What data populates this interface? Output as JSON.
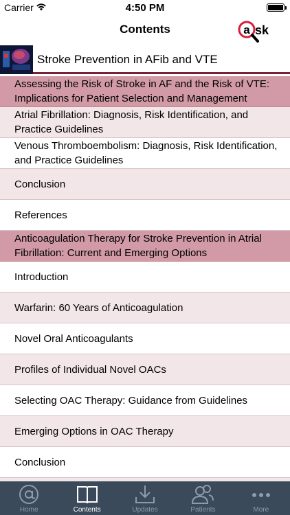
{
  "status": {
    "carrier": "Carrier",
    "time": "4:50 PM"
  },
  "nav": {
    "title": "Contents",
    "logo_text": "ask"
  },
  "book": {
    "title": "Stroke Prevention in AFib and VTE"
  },
  "list": [
    {
      "text": "Assessing the Risk of Stroke in AF and the Risk of VTE: Implications for Patient Selection and Management",
      "kind": "sec"
    },
    {
      "text": "Atrial Fibrillation: Diagnosis, Risk Identification, and Practice Guidelines",
      "kind": "alt"
    },
    {
      "text": "Venous Thromboembolism: Diagnosis, Risk Identification, and Practice Guidelines",
      "kind": "white"
    },
    {
      "text": "Conclusion",
      "kind": "alt"
    },
    {
      "text": "References",
      "kind": "white"
    },
    {
      "text": "Anticoagulation Therapy for Stroke Prevention in Atrial Fibrillation: Current and Emerging Options",
      "kind": "sec"
    },
    {
      "text": "Introduction",
      "kind": "white"
    },
    {
      "text": "Warfarin: 60 Years of Anticoagulation",
      "kind": "alt"
    },
    {
      "text": "Novel Oral Anticoagulants",
      "kind": "white"
    },
    {
      "text": "Profiles of Individual Novel OACs",
      "kind": "alt"
    },
    {
      "text": "Selecting OAC Therapy: Guidance from Guidelines",
      "kind": "white"
    },
    {
      "text": "Emerging Options in OAC Therapy",
      "kind": "alt"
    },
    {
      "text": "Conclusion",
      "kind": "white"
    },
    {
      "text": "",
      "kind": "alt"
    }
  ],
  "tabs": [
    {
      "label": "Home",
      "icon": "at-icon",
      "active": false
    },
    {
      "label": "Contents",
      "icon": "book-icon",
      "active": true
    },
    {
      "label": "Updates",
      "icon": "download-icon",
      "active": false
    },
    {
      "label": "Patients",
      "icon": "people-icon",
      "active": false
    },
    {
      "label": "More",
      "icon": "more-icon",
      "active": false
    }
  ],
  "colors": {
    "section": "#d19aa6",
    "alt": "#f3e6e9",
    "accent": "#7a2232",
    "tabbar": "#3a4a5a",
    "logo_red": "#d6203a"
  }
}
